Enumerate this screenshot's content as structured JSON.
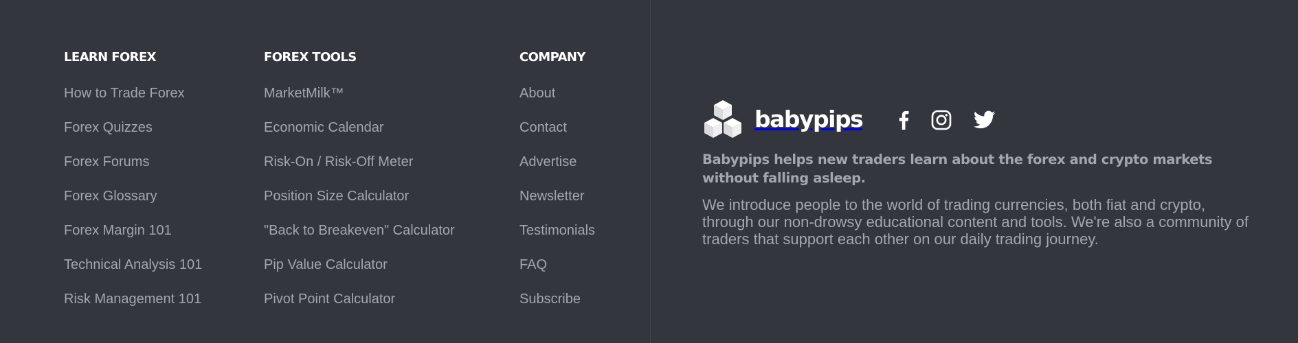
{
  "learn_forex": {
    "heading": "LEARN FOREX",
    "links": [
      "How to Trade Forex",
      "Forex Quizzes",
      "Forex Forums",
      "Forex Glossary",
      "Forex Margin 101",
      "Technical Analysis 101",
      "Risk Management 101"
    ]
  },
  "forex_tools": {
    "heading": "FOREX TOOLS",
    "links": [
      "MarketMilk™",
      "Economic Calendar",
      "Risk-On / Risk-Off Meter",
      "Position Size Calculator",
      "\"Back to Breakeven\" Calculator",
      "Pip Value Calculator",
      "Pivot Point Calculator"
    ]
  },
  "company": {
    "heading": "COMPANY",
    "links": [
      "About",
      "Contact",
      "Advertise",
      "Newsletter",
      "Testimonials",
      "FAQ",
      "Subscribe"
    ]
  },
  "brand": {
    "logo_text": "babypips",
    "logo_icon": "stacked-cubes-icon",
    "social_icons": [
      "facebook-icon",
      "instagram-icon",
      "twitter-icon"
    ],
    "tagline": "Babypips helps new traders learn about the forex and crypto markets without falling asleep.",
    "description": "We introduce people to the world of trading currencies, both fiat and crypto, through our non-drowsy educational content and tools. We're also a community of traders that support each other on our daily trading journey."
  },
  "colors": {
    "background": "#33363d",
    "heading": "#ffffff",
    "link": "#a3a7ad",
    "divider": "#3f434b"
  }
}
